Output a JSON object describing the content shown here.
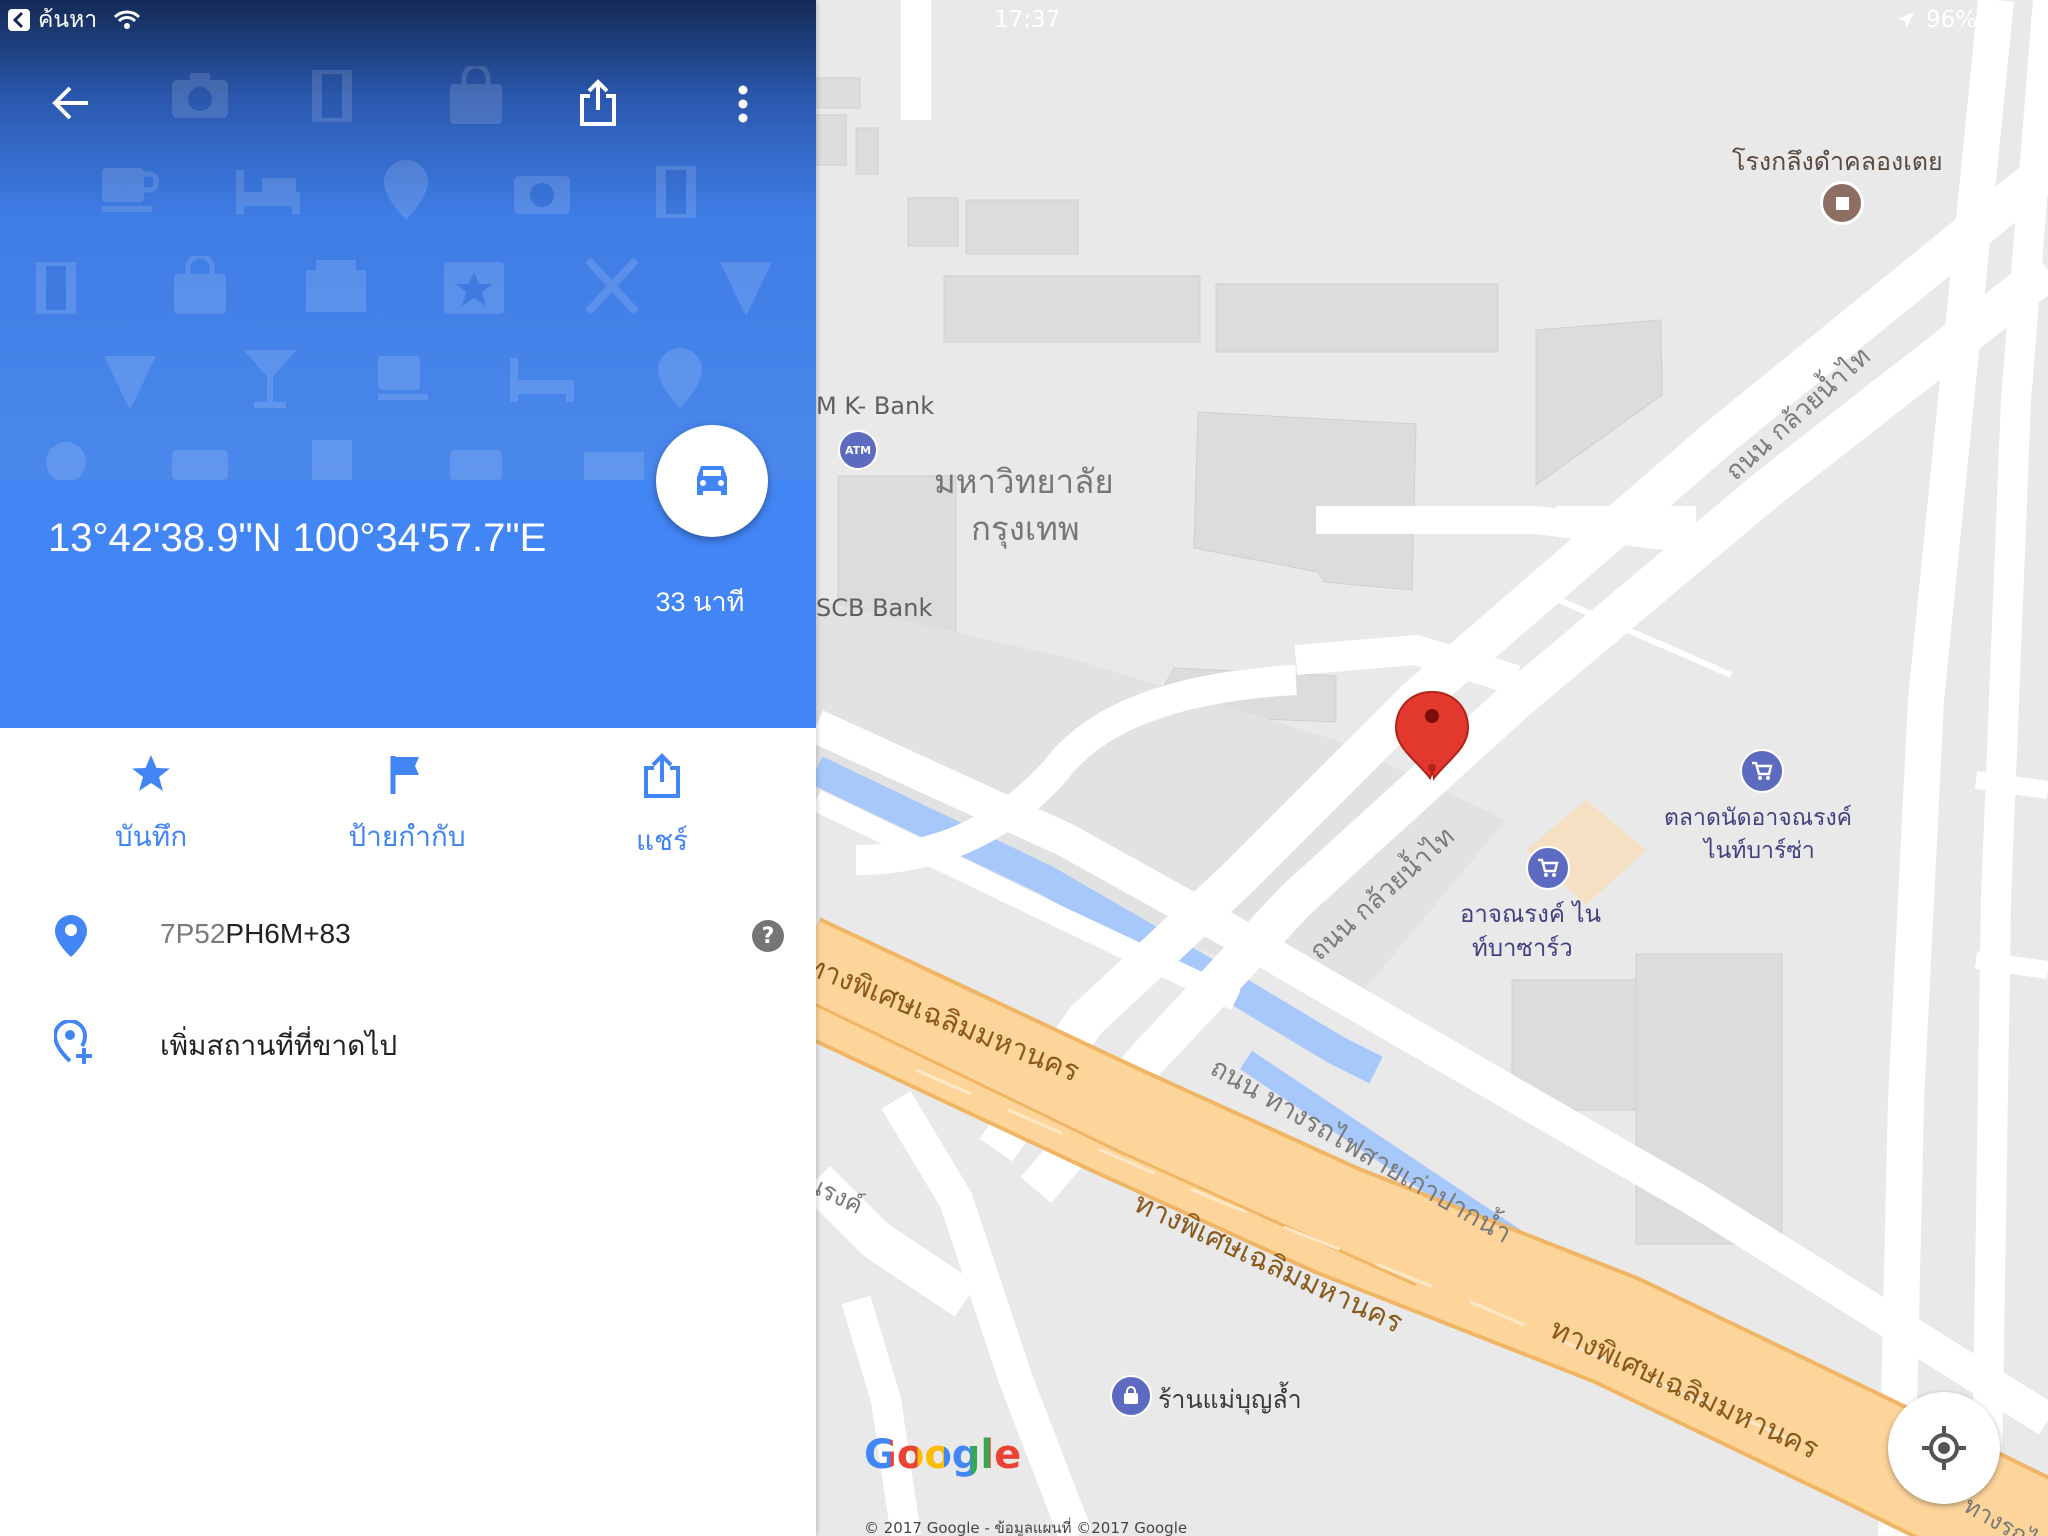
{
  "status_bar": {
    "back_app": "ค้นหา",
    "time": "17:37",
    "battery": "96%"
  },
  "header": {
    "coordinates": "13°42'38.9\"N 100°34'57.7\"E",
    "travel_time": "33 นาที"
  },
  "actions": [
    {
      "label": "บันทึก",
      "icon": "star-icon"
    },
    {
      "label": "ป้ายกำกับ",
      "icon": "flag-icon"
    },
    {
      "label": "แชร์",
      "icon": "share-icon"
    }
  ],
  "plus_code": {
    "prefix": "7P52",
    "code": "PH6M+83"
  },
  "add_place": "เพิ่มสถานที่ที่ขาดไป",
  "map": {
    "labels": {
      "tobacco": "โรงกลึงดำคลองเตย",
      "kbank": "M K- Bank",
      "atm": "ATM",
      "university_1": "มหาวิทยาลัย",
      "university_2": "กรุงเทพ",
      "scb": "SCB Bank",
      "road_kluay_upper": "ถนน กล้วยน้ำไท",
      "road_kluay_lower": "ถนน กล้วยน้ำไท",
      "market1_line1": "ตลาดนัดอาจณรงค์",
      "market1_line2": "ไนท์บาร์ซ่า",
      "market2_line1": "อาจณรงค์ ไน",
      "market2_line2": "ท์บาซาร์ว",
      "expressway_1": "ทางพิเศษเฉลิมมหานคร",
      "expressway_2": "ทางพิเศษเฉลิมมหานคร",
      "expressway_3": "ทางพิเศษเฉลิมมหานคร",
      "rail_road": "ถนน ทางรถไฟสายเก่าปากน้ำ",
      "narong": "นรงค์",
      "shop": "ร้านแม่บุญล้ำ",
      "corner_road": "ทางรถไ"
    },
    "logo": "Google",
    "copyright": "© 2017 Google - ข้อมูลแผนที่ ©2017 Google"
  },
  "colors": {
    "blue": "#4285f4",
    "expressway": "#fdd59a",
    "water": "#a7c8fa",
    "pin": "#e3382e"
  }
}
